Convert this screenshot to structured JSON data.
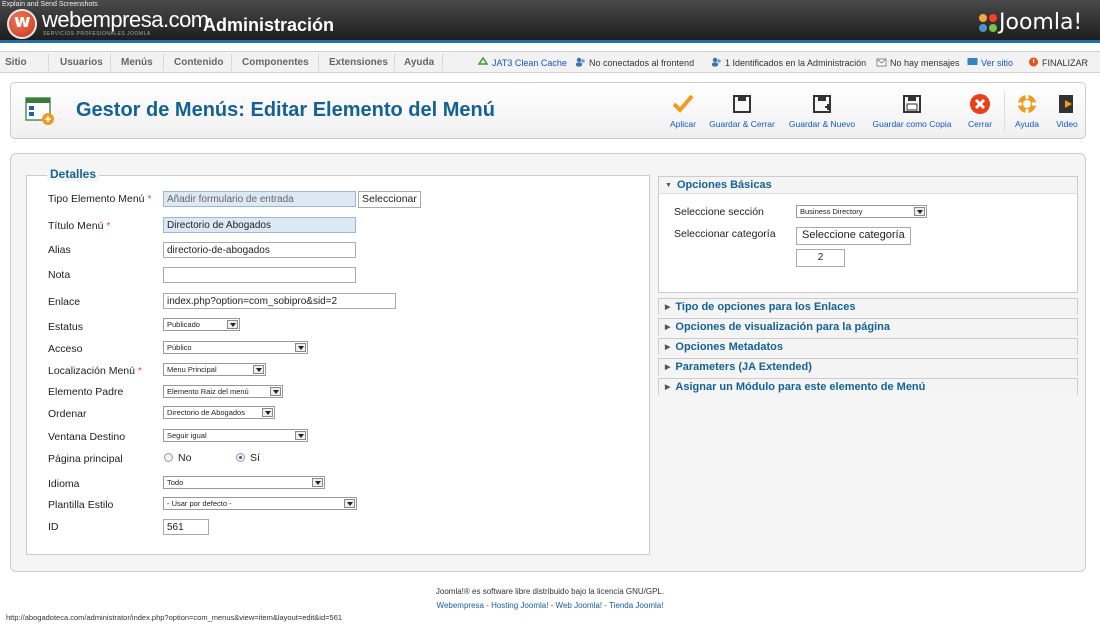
{
  "window": {
    "caption": "Explain and Send Screenshots"
  },
  "header": {
    "brand": "webempresa.com",
    "brand_sub": "SERVICIOS PROFESIONALES JOOMLA",
    "title": "Administración",
    "joomla_logo": "Joomla!"
  },
  "menubar": {
    "items": [
      "Sitio",
      "Usuarios",
      "Menús",
      "Contenido",
      "Componentes",
      "Extensiones",
      "Ayuda"
    ],
    "status": {
      "cache": "JAT3 Clean Cache",
      "frontend": "No conectados al frontend",
      "admins": "1 Identificados en la Administración",
      "messages": "No hay mensajes",
      "view_site": "Ver sitio",
      "logout": "FINALIZAR"
    }
  },
  "toolbar": {
    "title": "Gestor de Menús: Editar Elemento del Menú",
    "buttons": {
      "apply": "Aplicar",
      "save_close": "Guardar & Cerrar",
      "save_new": "Guardar & Nuevo",
      "save_copy": "Guardar como Copia",
      "close": "Cerrar",
      "help": "Ayuda",
      "video": "Video"
    }
  },
  "details": {
    "legend": "Detalles",
    "menu_item_type": {
      "label": "Tipo Elemento Menú",
      "value": "Añadir formulario de entrada",
      "button": "Seleccionar"
    },
    "menu_title": {
      "label": "Título Menú",
      "value": "Directorio de Abogados"
    },
    "alias": {
      "label": "Alias",
      "value": "directorio-de-abogados"
    },
    "note": {
      "label": "Nota",
      "value": ""
    },
    "link": {
      "label": "Enlace",
      "value": "index.php?option=com_sobipro&sid=2"
    },
    "status": {
      "label": "Estatus",
      "value": "Publicado"
    },
    "access": {
      "label": "Acceso",
      "value": "Público"
    },
    "menu_location": {
      "label": "Localización Menú",
      "value": "Menu Principal"
    },
    "parent": {
      "label": "Elemento Padre",
      "value": "Elemento Raiz del menú"
    },
    "ordering": {
      "label": "Ordenar",
      "value": "Directorio de Abogados"
    },
    "target_window": {
      "label": "Ventana Destino",
      "value": "Seguir igual"
    },
    "home": {
      "label": "Página principal",
      "no": "No",
      "yes": "Sí",
      "selected": "Sí"
    },
    "language": {
      "label": "Idioma",
      "value": "Todo"
    },
    "template_style": {
      "label": "Plantilla Estilo",
      "value": "- Usar por defecto -"
    },
    "id": {
      "label": "ID",
      "value": "561"
    }
  },
  "basic_options": {
    "title": "Opciones Básicas",
    "section": {
      "label": "Seleccione sección",
      "value": "Business Directory"
    },
    "category": {
      "label": "Seleccionar categoría",
      "button": "Seleccione categoría",
      "value": "2"
    }
  },
  "collapsed_panes": [
    "Tipo de opciones para los Enlaces",
    "Opciones de visualización para la página",
    "Opciones Metadatos",
    "Parameters (JA Extended)",
    "Asignar un Módulo para este elemento de Menú"
  ],
  "footer": {
    "license": "Joomla!® es software libre distribuido bajo la licencia GNU/GPL.",
    "links": "Webempresa - Hosting Joomla! - Web Joomla! - Tienda Joomla!"
  },
  "status_url": "http://abogadoteca.com/administrator/index.php?option=com_menus&view=item&layout=edit&id=561",
  "colors": {
    "accent": "#146295",
    "link": "#1155cc",
    "required": "#e8501a"
  }
}
